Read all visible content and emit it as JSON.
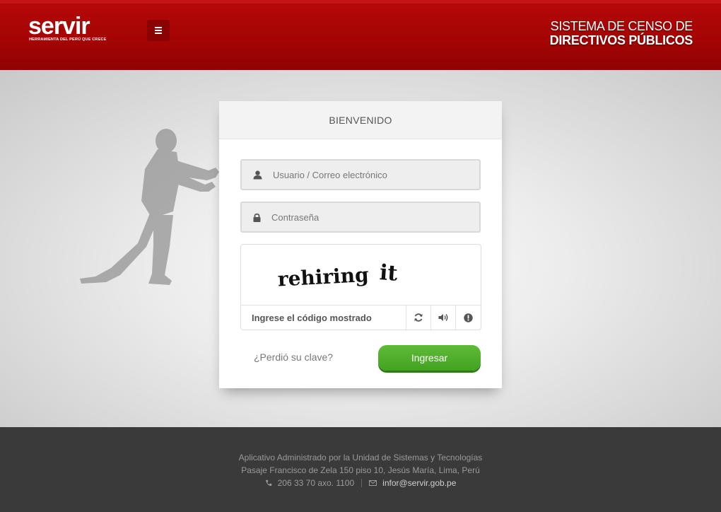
{
  "header": {
    "logo_text": "servir",
    "logo_tagline": "HERRAMIENTA DEL PERÚ QUE CRECE",
    "title_line1": "SISTEMA DE CENSO  DE",
    "title_line2": "DIRECTIVOS PÚBLICOS",
    "menu_icon": "hamburger-icon",
    "colors": {
      "header_red": "#a50404",
      "menu_button": "#8a0202"
    }
  },
  "login": {
    "title": "BIENVENIDO",
    "username_placeholder": "Usuario / Correo electrónico",
    "username_icon": "user-icon",
    "password_placeholder": "Contraseña",
    "password_icon": "lock-icon",
    "captcha": {
      "words": [
        "rehiring",
        "it"
      ],
      "input_placeholder": "Ingrese el código mostrado",
      "buttons": [
        "refresh-icon",
        "audio-icon",
        "help-icon"
      ]
    },
    "forgot_label": "¿Perdió su clave?",
    "submit_label": "Ingresar",
    "colors": {
      "submit_green": "#4cad29"
    }
  },
  "footer": {
    "line1": "Aplicativo Administrado por la Unidad de Sistemas y Tecnologías",
    "line2": "Pasaje Francisco de Zela 150 piso 10, Jesús María, Lima, Perú",
    "phone": "206 33 70 axo. 1100",
    "email": "infor@servir.gob.pe"
  }
}
